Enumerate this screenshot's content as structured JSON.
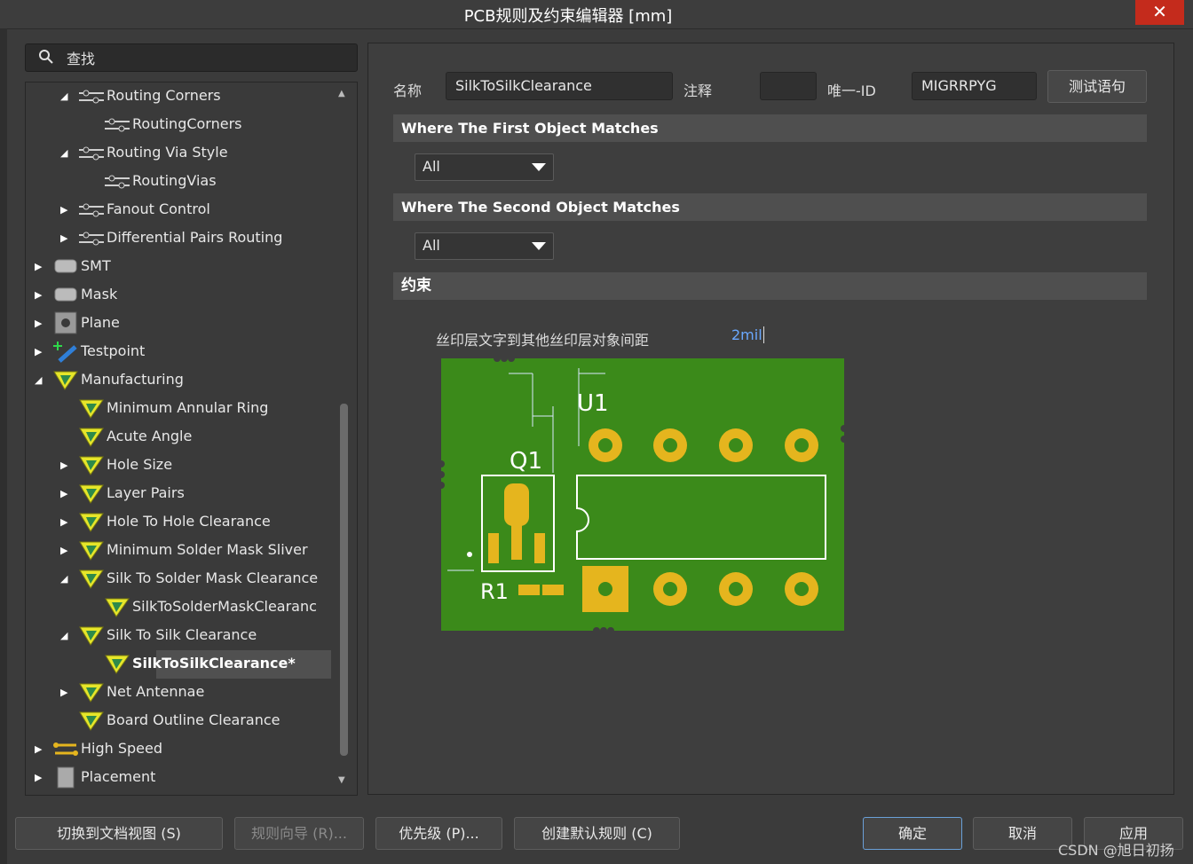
{
  "window": {
    "title": "PCB规则及约束编辑器 [mm]",
    "close_glyph": "✕"
  },
  "search": {
    "placeholder": "查找"
  },
  "tree": [
    {
      "label": "Routing Corners",
      "icon": "routing-icon",
      "arrow": "expanded"
    },
    {
      "label": "RoutingCorners",
      "icon": "routing-icon",
      "arrow": ""
    },
    {
      "label": "Routing Via Style",
      "icon": "routing-icon",
      "arrow": "expanded"
    },
    {
      "label": "RoutingVias",
      "icon": "routing-icon",
      "arrow": ""
    },
    {
      "label": "Fanout Control",
      "icon": "routing-icon",
      "arrow": "collapsed"
    },
    {
      "label": "Differential Pairs Routing",
      "icon": "routing-icon",
      "arrow": "collapsed"
    },
    {
      "label": "SMT",
      "icon": "smt-icon",
      "arrow": "collapsed"
    },
    {
      "label": "Mask",
      "icon": "mask-icon",
      "arrow": "collapsed"
    },
    {
      "label": "Plane",
      "icon": "plane-icon",
      "arrow": "collapsed"
    },
    {
      "label": "Testpoint",
      "icon": "testpoint-icon",
      "arrow": "collapsed"
    },
    {
      "label": "Manufacturing",
      "icon": "rule-icon",
      "arrow": "expanded"
    },
    {
      "label": "Minimum Annular Ring",
      "icon": "rule-icon",
      "arrow": ""
    },
    {
      "label": "Acute Angle",
      "icon": "rule-icon",
      "arrow": ""
    },
    {
      "label": "Hole Size",
      "icon": "rule-icon",
      "arrow": "collapsed"
    },
    {
      "label": "Layer Pairs",
      "icon": "rule-icon",
      "arrow": "collapsed"
    },
    {
      "label": "Hole To Hole Clearance",
      "icon": "rule-icon",
      "arrow": "collapsed"
    },
    {
      "label": "Minimum Solder Mask Sliver",
      "icon": "rule-icon",
      "arrow": "collapsed"
    },
    {
      "label": "Silk To Solder Mask Clearance",
      "icon": "rule-icon",
      "arrow": "expanded"
    },
    {
      "label": "SilkToSolderMaskClearanc",
      "icon": "rule-icon",
      "arrow": ""
    },
    {
      "label": "Silk To Silk Clearance",
      "icon": "rule-icon",
      "arrow": "expanded"
    },
    {
      "label": "SilkToSilkClearance*",
      "icon": "rule-icon",
      "arrow": "",
      "selected": true
    },
    {
      "label": "Net Antennae",
      "icon": "rule-icon",
      "arrow": "collapsed"
    },
    {
      "label": "Board Outline Clearance",
      "icon": "rule-icon",
      "arrow": ""
    },
    {
      "label": "High Speed",
      "icon": "highspeed-icon",
      "arrow": "collapsed"
    },
    {
      "label": "Placement",
      "icon": "placement-icon",
      "arrow": "collapsed"
    }
  ],
  "rule": {
    "name_label": "名称",
    "name_value": "SilkToSilkClearance",
    "comment_label": "注释",
    "comment_value": "",
    "uid_label": "唯一-ID",
    "uid_value": "MIGRRPYG",
    "test_button": "测试语句"
  },
  "first_match": {
    "header": "Where The First Object Matches",
    "value": "All"
  },
  "second_match": {
    "header": "Where The Second Object Matches",
    "value": "All"
  },
  "constraints": {
    "header": "约束",
    "label": "丝印层文字到其他丝印层对象间距",
    "value": "2mil"
  },
  "diagram": {
    "designators": {
      "u1": "U1",
      "q1": "Q1",
      "r1": "R1"
    },
    "colors": {
      "board": "#3b8a1a",
      "pad": "#e5b51e",
      "silk": "#ffffff"
    }
  },
  "footer": {
    "doc_view": "切换到文档视图 (S)",
    "wizard": "规则向导 (R)...",
    "priority": "优先级 (P)...",
    "default_rules": "创建默认规则 (C)",
    "ok": "确定",
    "cancel": "取消",
    "apply": "应用"
  },
  "watermark": "CSDN @旭日初扬"
}
